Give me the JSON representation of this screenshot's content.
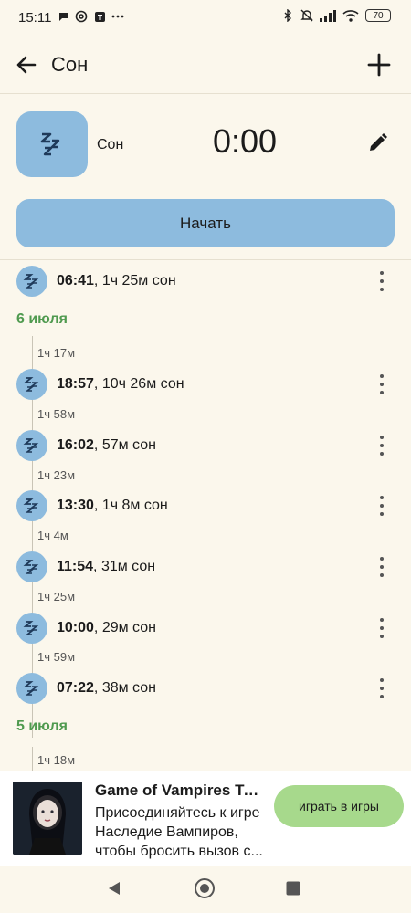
{
  "status_bar": {
    "time": "15:11",
    "left_icons": [
      "chat-bubble-icon",
      "at-sign-icon",
      "shield-icon",
      "more-dots-icon"
    ],
    "right_icons": [
      "bluetooth-icon",
      "muted-bell-icon",
      "signal-icon",
      "wifi-icon"
    ],
    "battery": "70"
  },
  "app_bar": {
    "title": "Сон"
  },
  "activity": {
    "name": "Сон",
    "timer": "0:00"
  },
  "start_button": {
    "label": "Начать"
  },
  "timeline": [
    {
      "type": "entry",
      "time": "06:41",
      "duration": ", 1ч 25м сон"
    },
    {
      "type": "date",
      "label": "6 июля"
    },
    {
      "type": "gap",
      "label": "1ч 17м"
    },
    {
      "type": "entry",
      "time": "18:57",
      "duration": ", 10ч 26м сон"
    },
    {
      "type": "gap",
      "label": "1ч 58м"
    },
    {
      "type": "entry",
      "time": "16:02",
      "duration": ", 57м сон"
    },
    {
      "type": "gap",
      "label": "1ч 23м"
    },
    {
      "type": "entry",
      "time": "13:30",
      "duration": ", 1ч 8м сон"
    },
    {
      "type": "gap",
      "label": "1ч 4м"
    },
    {
      "type": "entry",
      "time": "11:54",
      "duration": ", 31м сон"
    },
    {
      "type": "gap",
      "label": "1ч 25м"
    },
    {
      "type": "entry",
      "time": "10:00",
      "duration": ", 29м сон"
    },
    {
      "type": "gap",
      "label": "1ч 59м"
    },
    {
      "type": "entry",
      "time": "07:22",
      "duration": ", 38м сон"
    },
    {
      "type": "date",
      "label": "5 июля"
    },
    {
      "type": "gap",
      "label": "1ч 18м"
    }
  ],
  "ad": {
    "title": "Game of Vampires Twil...",
    "body": "Присоединяйтесь к игре Наследие Вампиров, чтобы бросить вызов с...",
    "cta": "играть в игры"
  },
  "nav_bar": {
    "icons": [
      "back-triangle-icon",
      "home-circle-icon",
      "recents-square-icon"
    ]
  },
  "colors": {
    "background": "#fbf7ec",
    "accent_blue": "#8dbbde",
    "date_green": "#4f9a4f",
    "cta_green": "#a7d98c"
  }
}
